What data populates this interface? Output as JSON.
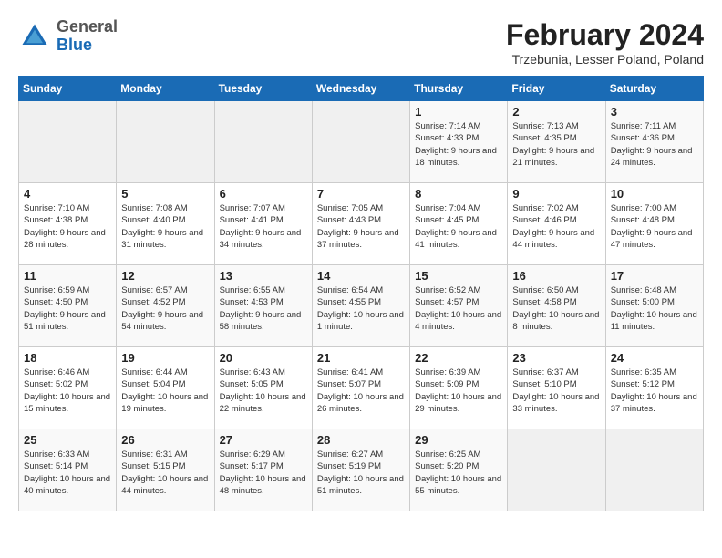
{
  "header": {
    "logo_general": "General",
    "logo_blue": "Blue",
    "title": "February 2024",
    "location": "Trzebunia, Lesser Poland, Poland"
  },
  "days_of_week": [
    "Sunday",
    "Monday",
    "Tuesday",
    "Wednesday",
    "Thursday",
    "Friday",
    "Saturday"
  ],
  "weeks": [
    [
      {
        "day": "",
        "info": ""
      },
      {
        "day": "",
        "info": ""
      },
      {
        "day": "",
        "info": ""
      },
      {
        "day": "",
        "info": ""
      },
      {
        "day": "1",
        "info": "Sunrise: 7:14 AM\nSunset: 4:33 PM\nDaylight: 9 hours\nand 18 minutes."
      },
      {
        "day": "2",
        "info": "Sunrise: 7:13 AM\nSunset: 4:35 PM\nDaylight: 9 hours\nand 21 minutes."
      },
      {
        "day": "3",
        "info": "Sunrise: 7:11 AM\nSunset: 4:36 PM\nDaylight: 9 hours\nand 24 minutes."
      }
    ],
    [
      {
        "day": "4",
        "info": "Sunrise: 7:10 AM\nSunset: 4:38 PM\nDaylight: 9 hours\nand 28 minutes."
      },
      {
        "day": "5",
        "info": "Sunrise: 7:08 AM\nSunset: 4:40 PM\nDaylight: 9 hours\nand 31 minutes."
      },
      {
        "day": "6",
        "info": "Sunrise: 7:07 AM\nSunset: 4:41 PM\nDaylight: 9 hours\nand 34 minutes."
      },
      {
        "day": "7",
        "info": "Sunrise: 7:05 AM\nSunset: 4:43 PM\nDaylight: 9 hours\nand 37 minutes."
      },
      {
        "day": "8",
        "info": "Sunrise: 7:04 AM\nSunset: 4:45 PM\nDaylight: 9 hours\nand 41 minutes."
      },
      {
        "day": "9",
        "info": "Sunrise: 7:02 AM\nSunset: 4:46 PM\nDaylight: 9 hours\nand 44 minutes."
      },
      {
        "day": "10",
        "info": "Sunrise: 7:00 AM\nSunset: 4:48 PM\nDaylight: 9 hours\nand 47 minutes."
      }
    ],
    [
      {
        "day": "11",
        "info": "Sunrise: 6:59 AM\nSunset: 4:50 PM\nDaylight: 9 hours\nand 51 minutes."
      },
      {
        "day": "12",
        "info": "Sunrise: 6:57 AM\nSunset: 4:52 PM\nDaylight: 9 hours\nand 54 minutes."
      },
      {
        "day": "13",
        "info": "Sunrise: 6:55 AM\nSunset: 4:53 PM\nDaylight: 9 hours\nand 58 minutes."
      },
      {
        "day": "14",
        "info": "Sunrise: 6:54 AM\nSunset: 4:55 PM\nDaylight: 10 hours\nand 1 minute."
      },
      {
        "day": "15",
        "info": "Sunrise: 6:52 AM\nSunset: 4:57 PM\nDaylight: 10 hours\nand 4 minutes."
      },
      {
        "day": "16",
        "info": "Sunrise: 6:50 AM\nSunset: 4:58 PM\nDaylight: 10 hours\nand 8 minutes."
      },
      {
        "day": "17",
        "info": "Sunrise: 6:48 AM\nSunset: 5:00 PM\nDaylight: 10 hours\nand 11 minutes."
      }
    ],
    [
      {
        "day": "18",
        "info": "Sunrise: 6:46 AM\nSunset: 5:02 PM\nDaylight: 10 hours\nand 15 minutes."
      },
      {
        "day": "19",
        "info": "Sunrise: 6:44 AM\nSunset: 5:04 PM\nDaylight: 10 hours\nand 19 minutes."
      },
      {
        "day": "20",
        "info": "Sunrise: 6:43 AM\nSunset: 5:05 PM\nDaylight: 10 hours\nand 22 minutes."
      },
      {
        "day": "21",
        "info": "Sunrise: 6:41 AM\nSunset: 5:07 PM\nDaylight: 10 hours\nand 26 minutes."
      },
      {
        "day": "22",
        "info": "Sunrise: 6:39 AM\nSunset: 5:09 PM\nDaylight: 10 hours\nand 29 minutes."
      },
      {
        "day": "23",
        "info": "Sunrise: 6:37 AM\nSunset: 5:10 PM\nDaylight: 10 hours\nand 33 minutes."
      },
      {
        "day": "24",
        "info": "Sunrise: 6:35 AM\nSunset: 5:12 PM\nDaylight: 10 hours\nand 37 minutes."
      }
    ],
    [
      {
        "day": "25",
        "info": "Sunrise: 6:33 AM\nSunset: 5:14 PM\nDaylight: 10 hours\nand 40 minutes."
      },
      {
        "day": "26",
        "info": "Sunrise: 6:31 AM\nSunset: 5:15 PM\nDaylight: 10 hours\nand 44 minutes."
      },
      {
        "day": "27",
        "info": "Sunrise: 6:29 AM\nSunset: 5:17 PM\nDaylight: 10 hours\nand 48 minutes."
      },
      {
        "day": "28",
        "info": "Sunrise: 6:27 AM\nSunset: 5:19 PM\nDaylight: 10 hours\nand 51 minutes."
      },
      {
        "day": "29",
        "info": "Sunrise: 6:25 AM\nSunset: 5:20 PM\nDaylight: 10 hours\nand 55 minutes."
      },
      {
        "day": "",
        "info": ""
      },
      {
        "day": "",
        "info": ""
      }
    ]
  ]
}
